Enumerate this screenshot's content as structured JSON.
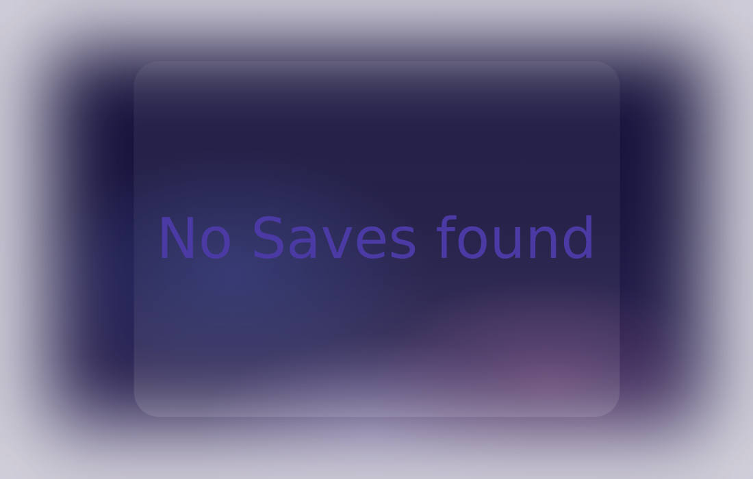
{
  "saves_panel": {
    "empty_message": "No Saves found"
  },
  "colors": {
    "message_text": "#4b3aa3",
    "backdrop_dark": "#15103a",
    "vignette_light": "#d4d2dc"
  }
}
